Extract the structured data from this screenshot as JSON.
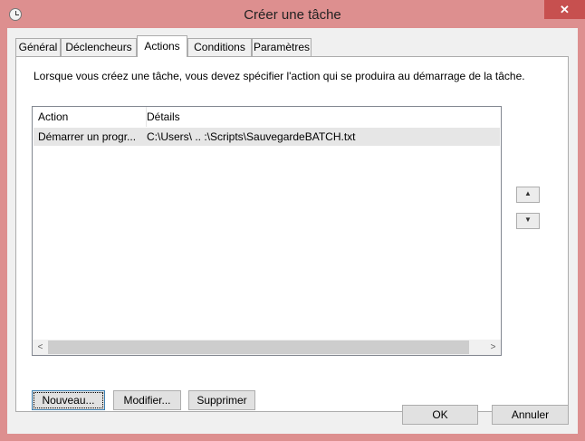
{
  "window": {
    "title": "Créer une tâche",
    "close_glyph": "✕",
    "icon": "clock-icon"
  },
  "tabs": [
    {
      "label": "Général"
    },
    {
      "label": "Déclencheurs"
    },
    {
      "label": "Actions"
    },
    {
      "label": "Conditions"
    },
    {
      "label": "Paramètres"
    }
  ],
  "active_tab": "Actions",
  "panel": {
    "description": "Lorsque vous créez une tâche, vous devez spécifier l'action qui se produira au démarrage de la tâche."
  },
  "actions_list": {
    "columns": [
      "Action",
      "Détails"
    ],
    "rows": [
      {
        "action": "Démarrer un progr...",
        "details": "C:\\Users\\ .. :\\Scripts\\SauvegardeBATCH.txt"
      }
    ],
    "scroll_left": "<",
    "scroll_right": ">"
  },
  "move_buttons": {
    "up": "▲",
    "down": "▼"
  },
  "list_buttons": {
    "new": "Nouveau...",
    "modify": "Modifier...",
    "delete": "Supprimer"
  },
  "footer": {
    "ok": "OK",
    "cancel": "Annuler"
  },
  "colors": {
    "title_bar": "#dd8f8f",
    "close_button": "#c7504f",
    "selected_row": "#e6e6e6"
  }
}
